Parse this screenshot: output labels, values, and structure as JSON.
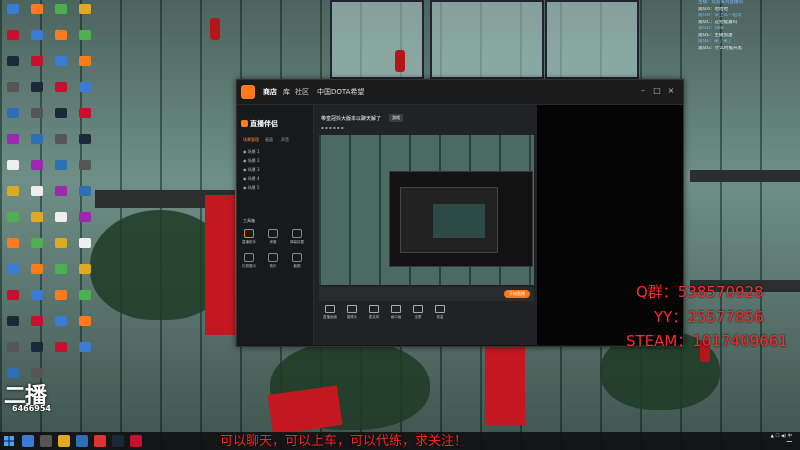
{
  "main_window": {
    "tabs": [
      "商店",
      "库",
      "社区",
      "中国DOTA希望"
    ]
  },
  "app": {
    "logo_text": "直播伴侣",
    "sidebar_tabs": [
      "场景管理",
      "画面",
      "声音"
    ],
    "scenes": [
      "场景 1",
      "场景 2",
      "场景 3",
      "场景 4",
      "场景 5"
    ],
    "tools_title": "工具箱",
    "tools": [
      "直播助手",
      "房管",
      "弹幕设置",
      "礼物展示",
      "音乐",
      "截图"
    ],
    "room_title": "带皇冠抖大版本以聊天解了",
    "room_tag": "游戏",
    "controls": [
      "直播画面",
      "摄像头",
      "麦克风",
      "画中画",
      "全屏",
      "音量"
    ],
    "go_live_label": "开始直播"
  },
  "overlay": {
    "qq_line": "Q群：538570928",
    "yy_line": "YY：25577856",
    "steam_line": "STEAM：1017409661",
    "subtitle": "可以聊天，可以上车，可以代练，求关注！",
    "cover_logo": "二播",
    "cover_number": "6466954"
  },
  "chat": {
    "lines": [
      "主播：欢迎来到直播间",
      "观众A：哈哈哈",
      "观众B：求上车一起玩",
      "观众C：这把能赢吗",
      "观众D：666",
      "观众E：主播加油",
      "观众F：来了来了",
      "观众G：什么时候开黑"
    ]
  },
  "colors": {
    "accent": "#ff7a1a",
    "overlay_red": "#ff2a2a",
    "taskbar": "#101012"
  }
}
